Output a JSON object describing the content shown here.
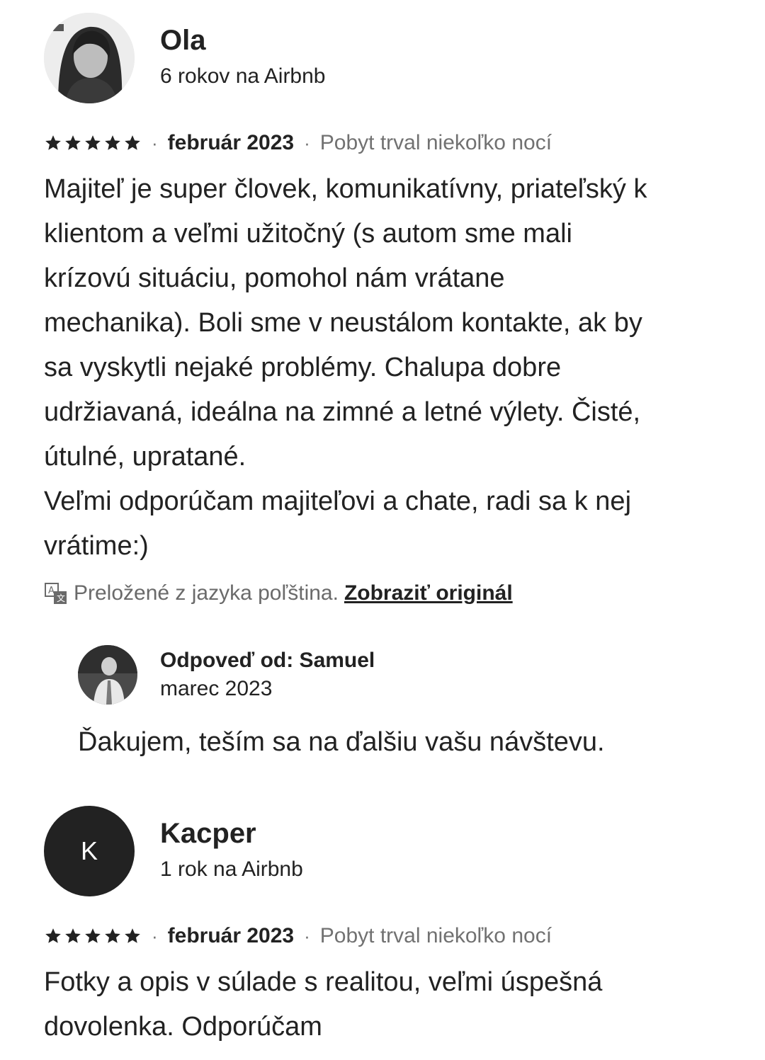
{
  "reviews": [
    {
      "reviewer": {
        "name": "Ola",
        "tenure": "6 rokov na Airbnb",
        "avatar": "photo"
      },
      "rating_stars": 5,
      "separator": "·",
      "date": "február 2023",
      "stay_length": "Pobyt trval niekoľko nocí",
      "text": "Majiteľ je super človek, komunikatívny, priateľský k\nklientom a veľmi užitočný (s autom sme mali\nkrízovú situáciu, pomohol nám vrátane\nmechanika). Boli sme v neustálom kontakte, ak by\nsa vyskytli nejaké problémy. Chalupa dobre\nudržiavaná, ideálna na zimné a letné výlety. Čisté,\nútulné, upratané.\nVeľmi odporúčam majiteľovi a chate, radi sa k nej\nvrátime:)",
      "translation": {
        "icon": "translate-icon",
        "note": "Preložené z jazyka poľština.",
        "link_label": "Zobraziť originál"
      },
      "host_reply": {
        "title": "Odpoveď od: Samuel",
        "date": "marec 2023",
        "text": "Ďakujem, teším sa na ďalšiu vašu návštevu."
      }
    },
    {
      "reviewer": {
        "name": "Kacper",
        "tenure": "1 rok na Airbnb",
        "avatar_letter": "K"
      },
      "rating_stars": 5,
      "separator": "·",
      "date": "február 2023",
      "stay_length": "Pobyt trval niekoľko nocí",
      "text": "Fotky a opis v súlade s realitou, veľmi úspešná\ndovolenka. Odporúčam"
    }
  ],
  "colors": {
    "text_primary": "#222222",
    "text_secondary": "#717171",
    "avatar_letter_bg": "#222222"
  }
}
